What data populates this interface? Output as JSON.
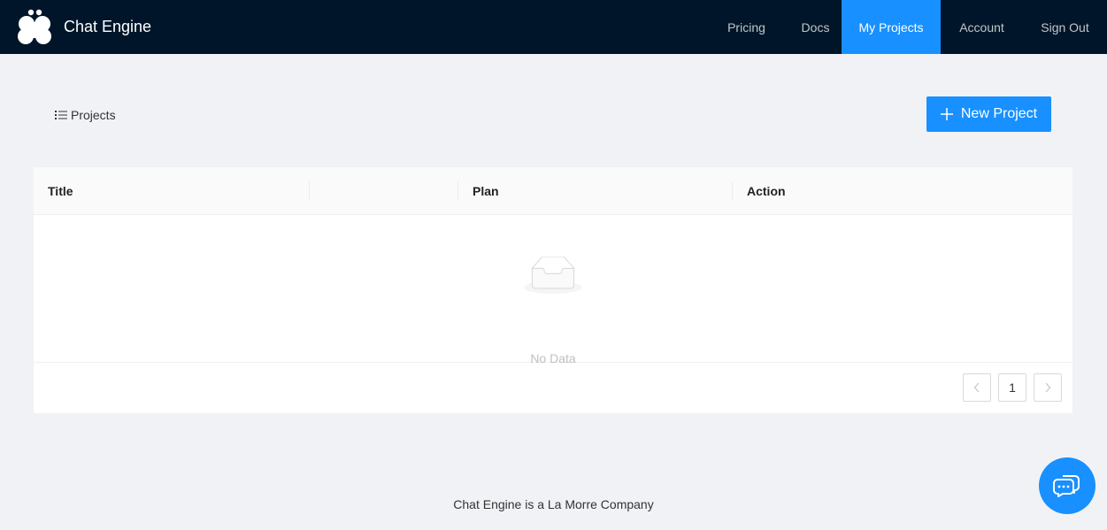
{
  "header": {
    "brand": "Chat Engine",
    "logo_icon": "chat-engine-logo-icon",
    "nav": [
      {
        "label": "Pricing",
        "active": false
      },
      {
        "label": "Docs",
        "active": false
      },
      {
        "label": "My Projects",
        "active": true
      },
      {
        "label": "Account",
        "active": false
      },
      {
        "label": "Sign Out",
        "active": false
      }
    ]
  },
  "toolbar": {
    "projects_label": "Projects",
    "projects_icon": "list-icon",
    "new_project_label": "New Project",
    "new_project_icon": "plus-icon"
  },
  "table": {
    "columns": [
      "Title",
      "",
      "Plan",
      "Action"
    ],
    "rows": [],
    "empty_text": "No Data",
    "empty_icon": "empty-inbox-icon"
  },
  "pagination": {
    "prev_icon": "chevron-left-icon",
    "current_page": "1",
    "next_icon": "chevron-right-icon"
  },
  "footer": {
    "text": "Chat Engine is a La Morre Company"
  },
  "chat_widget": {
    "icon": "chat-bubbles-icon"
  },
  "colors": {
    "header_bg": "#001529",
    "accent": "#1890ff",
    "page_bg": "#f0f2f5"
  }
}
